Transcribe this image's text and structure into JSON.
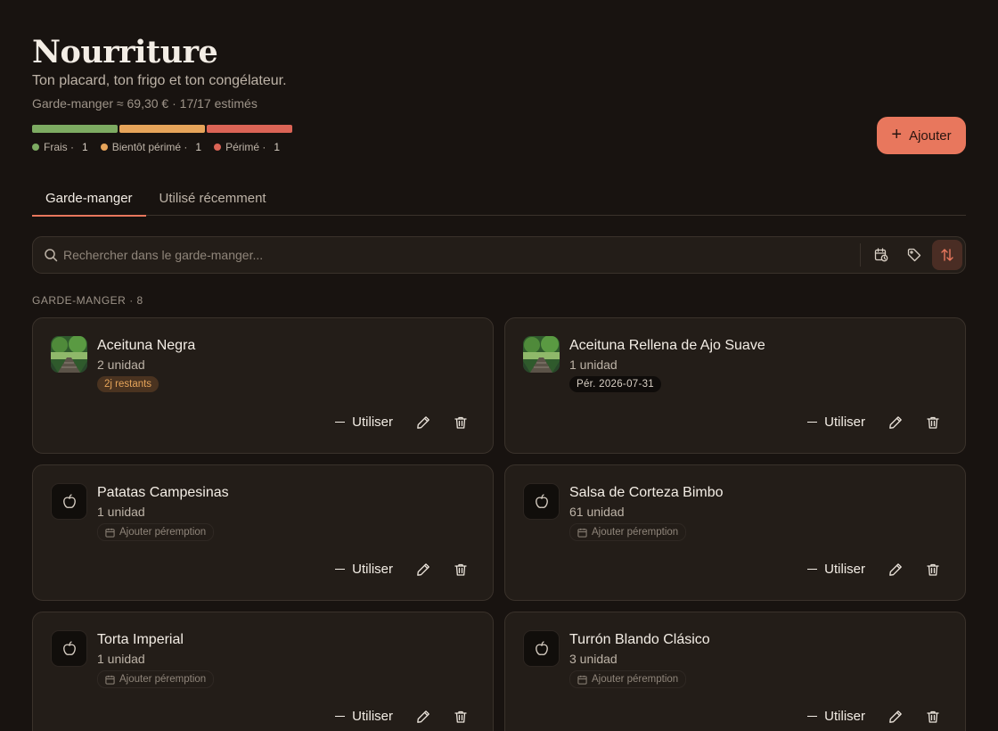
{
  "header": {
    "title": "Nourriture",
    "subtitle": "Ton placard, ton frigo et ton congélateur.",
    "summary": "Garde-manger ≈ 69,30 € · 17/17 estimés",
    "add_label": "Ajouter"
  },
  "status": {
    "colors": {
      "fresh": "#7dab62",
      "soon": "#e6a45a",
      "expired": "#db6456"
    },
    "legend": [
      {
        "label": "Frais ·",
        "count": "1"
      },
      {
        "label": "Bientôt périmé ·",
        "count": "1"
      },
      {
        "label": "Périmé ·",
        "count": "1"
      }
    ]
  },
  "tabs": [
    {
      "label": "Garde-manger",
      "active": true
    },
    {
      "label": "Utilisé récemment",
      "active": false
    }
  ],
  "search": {
    "placeholder": "Rechercher dans le garde-manger...",
    "icons": [
      "search-icon",
      "calendar-clock-icon",
      "tag-icon",
      "sort-icon"
    ]
  },
  "section": {
    "label": "GARDE-MANGER",
    "count": "· 8"
  },
  "actions": {
    "use_label": "Utiliser"
  },
  "items": [
    {
      "name": "Aceituna Negra",
      "qty": "2 unidad",
      "badge": "2j restants",
      "badge_type": "warn",
      "thumb": "photo"
    },
    {
      "name": "Aceituna Rellena de Ajo Suave",
      "qty": "1 unidad",
      "badge": "Pér. 2026-07-31",
      "badge_type": "date",
      "thumb": "photo"
    },
    {
      "name": "Patatas Campesinas",
      "qty": "1 unidad",
      "badge": "Ajouter péremption",
      "badge_type": "add",
      "thumb": "apple-icon"
    },
    {
      "name": "Salsa de Corteza Bimbo",
      "qty": "61 unidad",
      "badge": "Ajouter péremption",
      "badge_type": "add",
      "thumb": "apple-icon"
    },
    {
      "name": "Torta Imperial",
      "qty": "1 unidad",
      "badge": "Ajouter péremption",
      "badge_type": "add",
      "thumb": "apple-icon"
    },
    {
      "name": "Turrón Blando Clásico",
      "qty": "3 unidad",
      "badge": "Ajouter péremption",
      "badge_type": "add",
      "thumb": "apple-icon"
    }
  ]
}
